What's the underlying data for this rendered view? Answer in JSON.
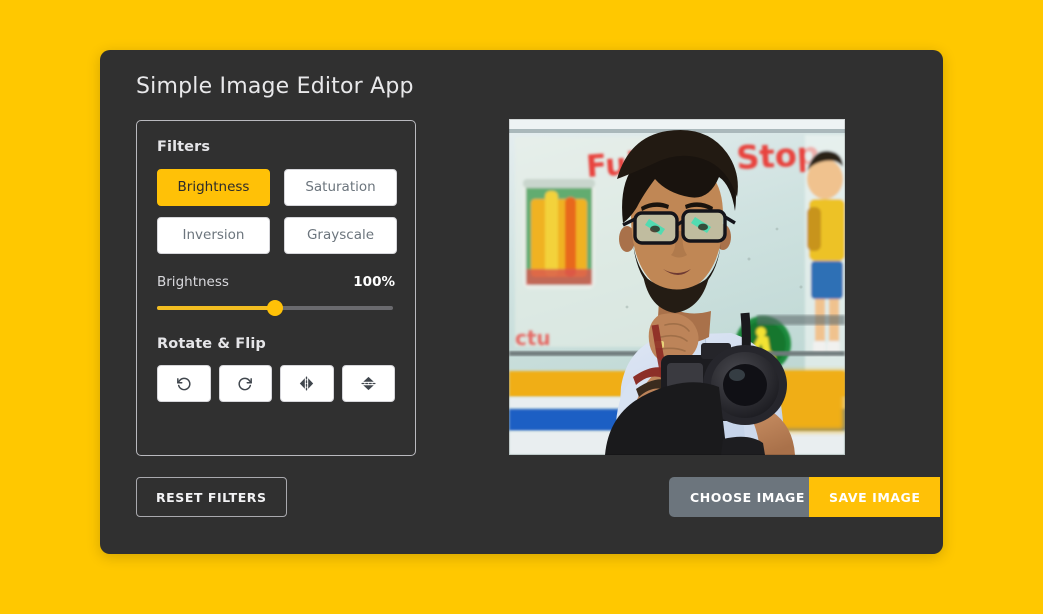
{
  "app": {
    "title": "Simple Image Editor App",
    "background_color": "#ffc800",
    "card_color": "#303030",
    "accent_color": "#ffc107"
  },
  "filters": {
    "heading": "Filters",
    "options": [
      {
        "label": "Brightness",
        "active": true
      },
      {
        "label": "Saturation",
        "active": false
      },
      {
        "label": "Inversion",
        "active": false
      },
      {
        "label": "Grayscale",
        "active": false
      }
    ]
  },
  "slider": {
    "name": "Brightness",
    "value_label": "100%",
    "value": 100,
    "min": 0,
    "max": 200,
    "percent_of_track": 50
  },
  "rotate_flip": {
    "heading": "Rotate & Flip",
    "buttons": [
      {
        "name": "rotate-left-icon",
        "title": "Rotate left"
      },
      {
        "name": "rotate-right-icon",
        "title": "Rotate right"
      },
      {
        "name": "flip-horizontal-icon",
        "title": "Flip horizontal"
      },
      {
        "name": "flip-vertical-icon",
        "title": "Flip vertical"
      }
    ]
  },
  "preview": {
    "alt": "Photo of a bearded man wearing glasses holding a DSLR camera, seated in front of a painted wall mural with the words Full and Stop",
    "mural_text_left": "Full",
    "mural_text_right": "Stop"
  },
  "actions": {
    "reset_label": "RESET FILTERS",
    "choose_label": "CHOOSE IMAGE",
    "save_label": "SAVE IMAGE"
  }
}
